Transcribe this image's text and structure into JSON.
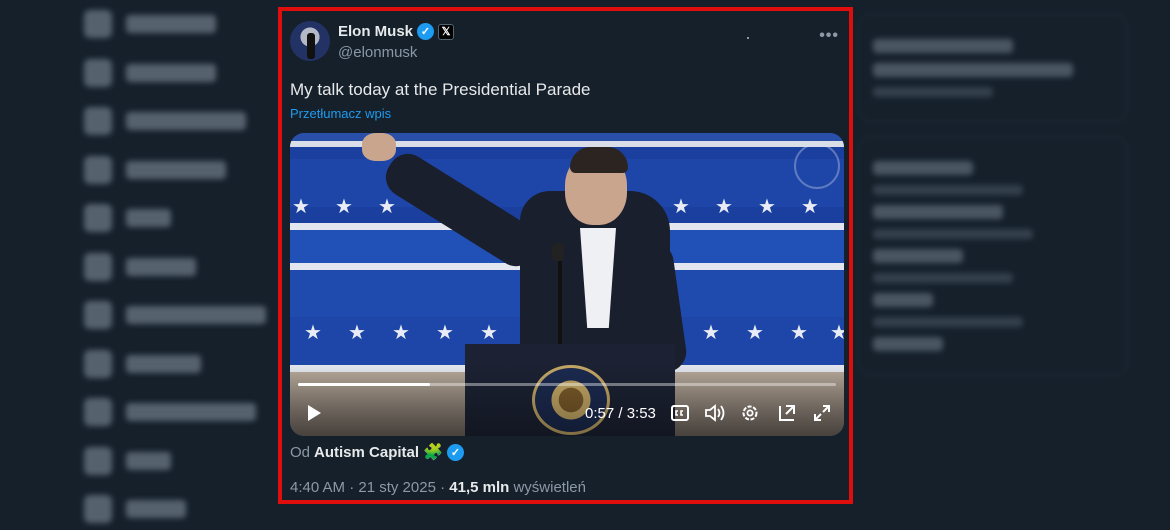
{
  "tweet": {
    "author_name": "Elon Musk",
    "verified_glyph": "✓",
    "x_badge_glyph": "𝕏",
    "handle": "@elonmusk",
    "more_glyph": "•••",
    "text": "My talk today at the Presidential Parade",
    "translate_label": "Przetłumacz wpis",
    "source_prefix": "Od",
    "source_name": "Autism Capital",
    "source_emoji": "🧩",
    "timestamp": "4:40 AM · 21 sty 2025 ·",
    "views_count": "41,5 mln",
    "views_label": "wyświetleń"
  },
  "video": {
    "time_display": "0:57 / 3:53",
    "progress_fraction": 0.246
  },
  "icons": {
    "verified": "verified-icon",
    "x_badge": "x-badge-icon",
    "more": "more-icon",
    "play": "play-icon",
    "cc": "cc-icon",
    "volume": "volume-icon",
    "settings": "settings-icon",
    "pip": "pip-icon",
    "fullscreen": "fullscreen-icon",
    "puzzle": "puzzle-icon"
  },
  "colors": {
    "highlight_border": "#e00d0d",
    "link": "#1d9bf0",
    "background": "#15202b"
  }
}
